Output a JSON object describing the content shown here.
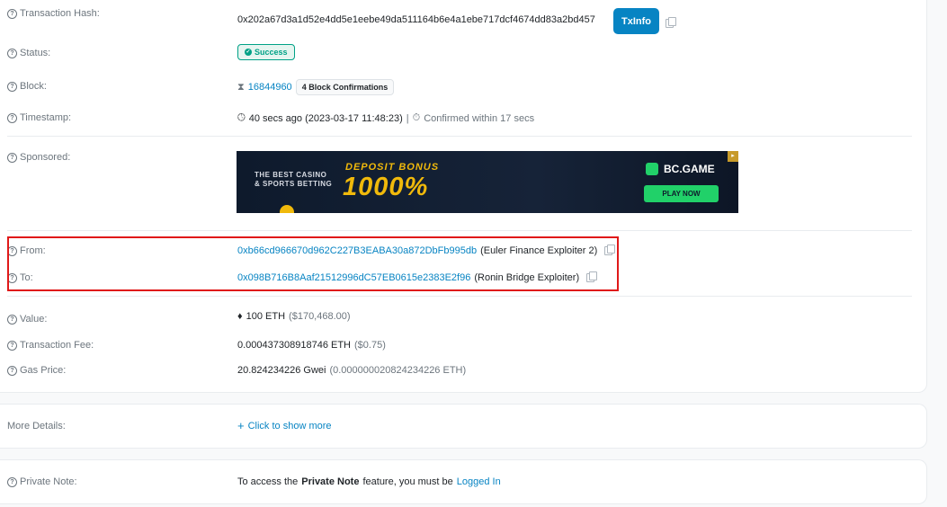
{
  "tx": {
    "hash_label": "Transaction Hash:",
    "hash_value": "0x202a67d3a1d52e4dd5e1eebe49da511164b6e4a1ebe717dcf4674dd83a2bd457",
    "txinfo_button": "TxInfo",
    "status_label": "Status:",
    "status_value": "Success",
    "block_label": "Block:",
    "block_number": "16844960",
    "block_confirmations": "4 Block Confirmations",
    "timestamp_label": "Timestamp:",
    "timestamp_value": "40 secs ago (2023-03-17 11:48:23)",
    "timestamp_sep": "|",
    "timestamp_confirmed": "Confirmed within 17 secs",
    "sponsored_label": "Sponsored:",
    "from_label": "From:",
    "from_address": "0xb66cd966670d962C227B3EABA30a872DbFb995db",
    "from_name": "(Euler Finance Exploiter 2)",
    "to_label": "To:",
    "to_address": "0x098B716B8Aaf21512996dC57EB0615e2383E2f96",
    "to_name": "(Ronin Bridge Exploiter)",
    "value_label": "Value:",
    "value_eth": "100 ETH",
    "value_usd": "($170,468.00)",
    "fee_label": "Transaction Fee:",
    "fee_eth": "0.000437308918746 ETH",
    "fee_usd": "($0.75)",
    "gas_label": "Gas Price:",
    "gas_gwei": "20.824234226 Gwei",
    "gas_eth": "(0.000000020824234226 ETH)"
  },
  "banner": {
    "line1": "THE BEST CASINO",
    "line2": "& SPORTS BETTING",
    "deposit": "DEPOSIT BONUS",
    "percent": "1000%",
    "brand": "BC.GAME",
    "cta": "PLAY NOW"
  },
  "more": {
    "label": "More Details:",
    "link": "Click to show more"
  },
  "note": {
    "label": "Private Note:",
    "text_before": "To access the",
    "text_bold": "Private Note",
    "text_after": "feature, you must be",
    "login_link": "Logged In"
  },
  "colors": {
    "accent": "#0784c3",
    "success": "#00a186",
    "highlight": "#e01919"
  }
}
